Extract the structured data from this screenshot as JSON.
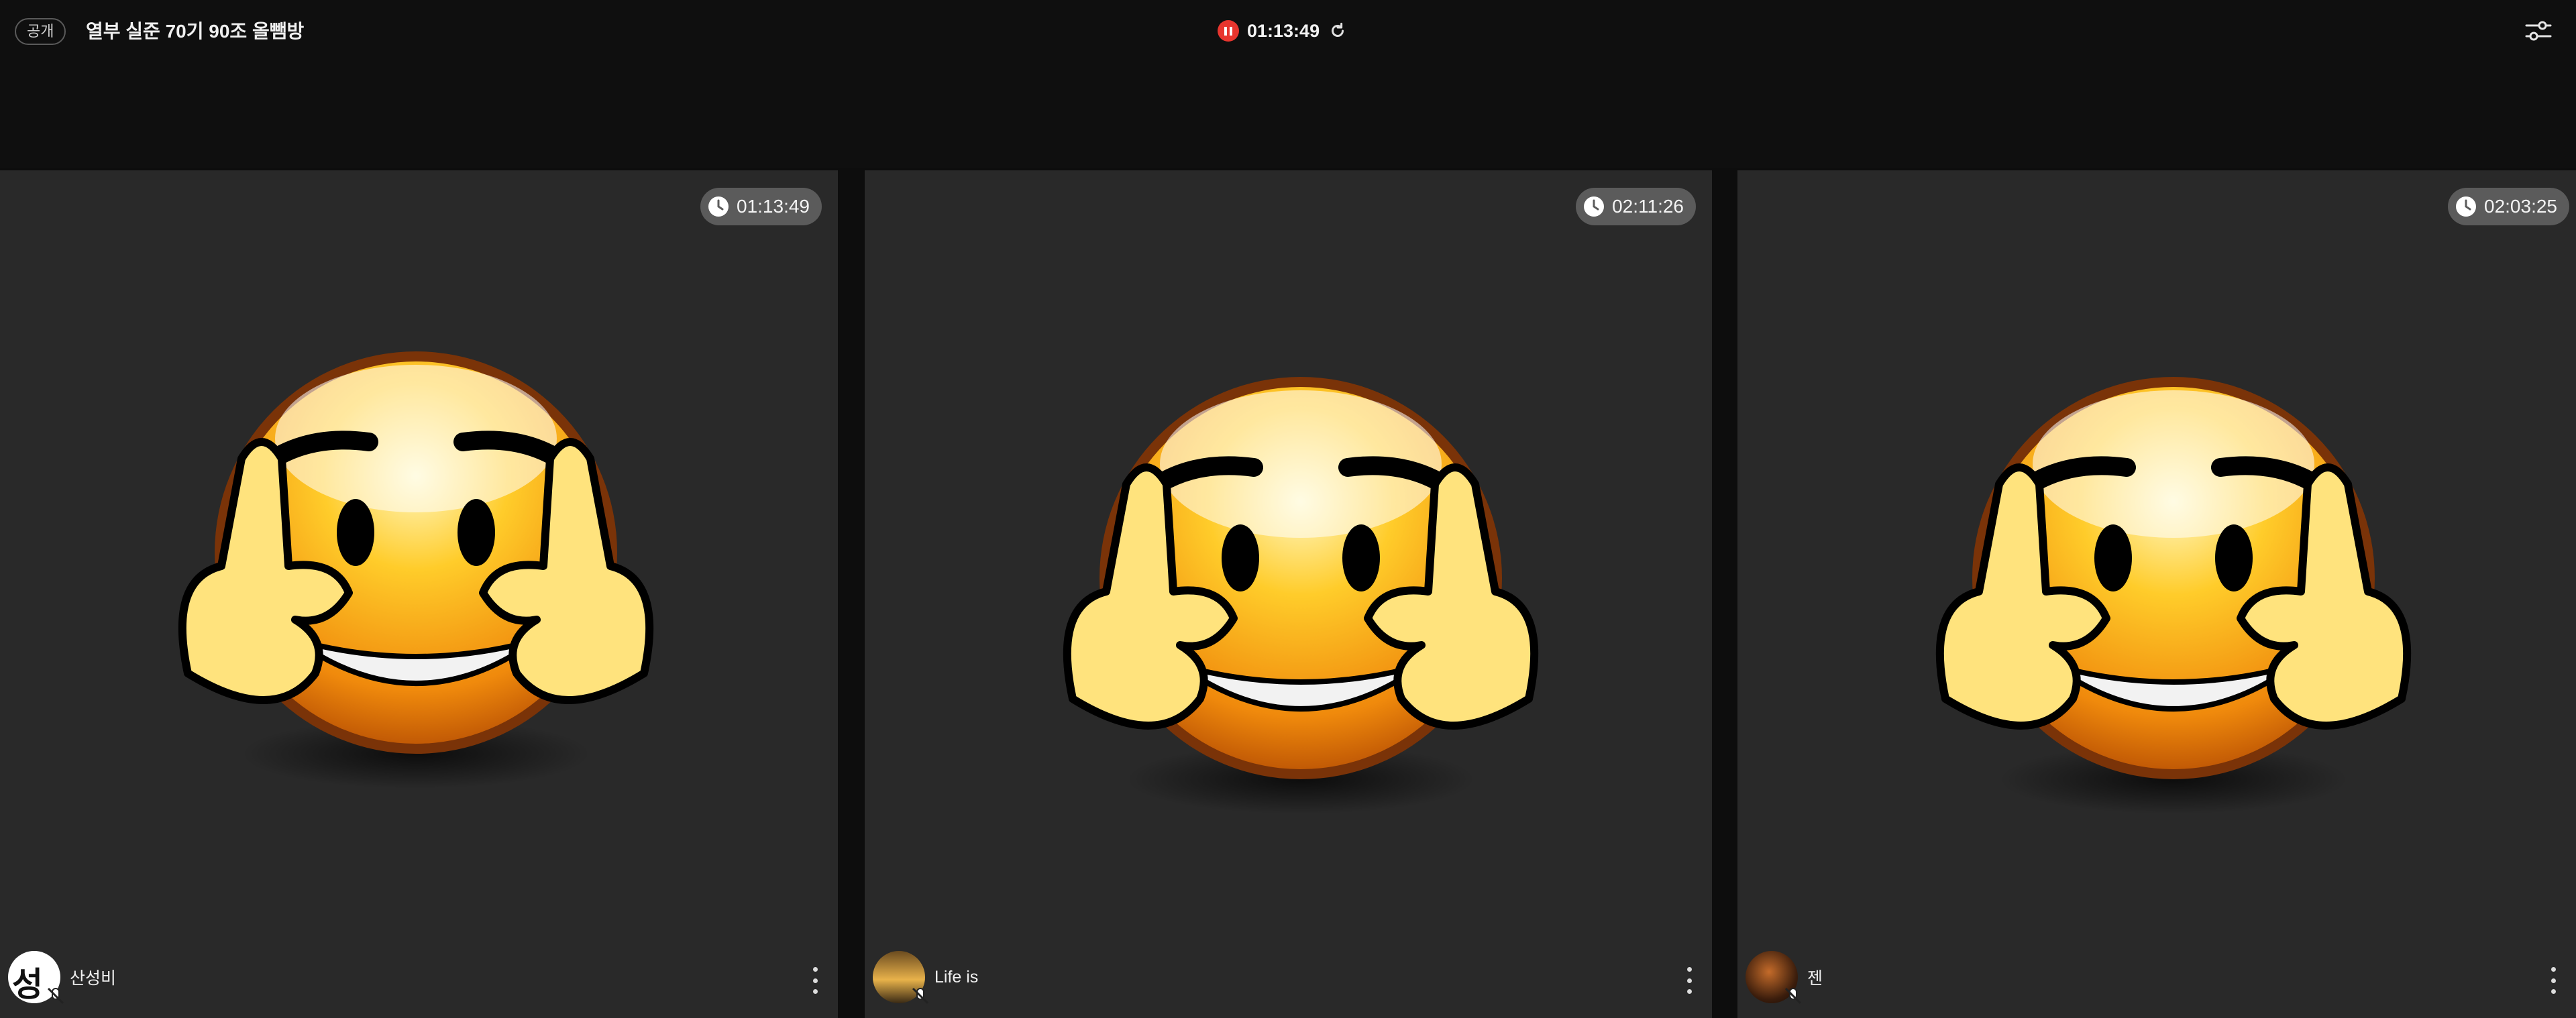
{
  "header": {
    "visibility_badge": "공개",
    "room_title": "열부 실준 70기 90조 올뺌방",
    "session_timer": "01:13:49",
    "icons": [
      "pause-icon",
      "refresh-icon",
      "settings-sliders-icon"
    ]
  },
  "participants": [
    {
      "name": "산성비",
      "timer": "01:13:49",
      "avatar_text": "성"
    },
    {
      "name": "Life is",
      "timer": "02:11:26"
    },
    {
      "name": "젠",
      "timer": "02:03:25"
    }
  ],
  "colors": {
    "record_red": "#e8352e",
    "tile_bg": "#292929",
    "pill_bg": "#5b5b5b"
  }
}
